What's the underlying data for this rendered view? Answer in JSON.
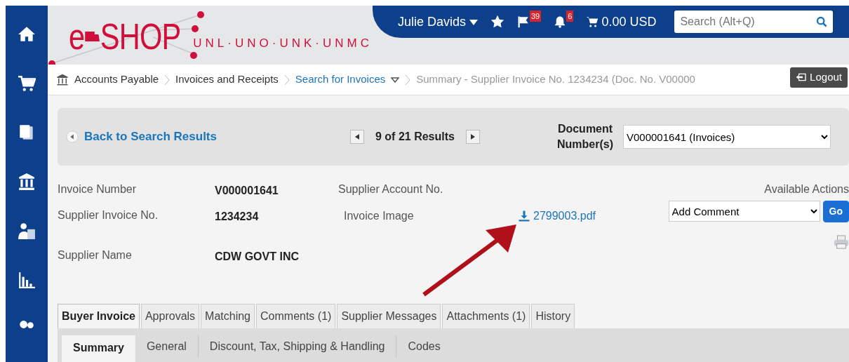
{
  "header": {
    "logo_letter": "e",
    "logo_word": "SHOP",
    "campuses": "UNL·UNO·UNK·UNMC",
    "user": "Julie Davids",
    "flag_count": "39",
    "notification_count": "6",
    "cart_total": "0.00 USD",
    "search": {
      "placeholder": "Search (Alt+Q)"
    }
  },
  "breadcrumb": [
    {
      "label": "Accounts Payable",
      "kind": "root"
    },
    {
      "label": "Invoices and Receipts",
      "kind": "plain"
    },
    {
      "label": "Search for Invoices",
      "kind": "menu"
    },
    {
      "label": "Summary - Supplier Invoice No. 1234234 (Doc. No. V00000",
      "kind": "current"
    }
  ],
  "logout": "Logout",
  "results_bar": {
    "back": "Back to Search Results",
    "position": "9 of 21 Results",
    "document_label": "Document Number(s)",
    "document_value": "V000001641 (Invoices)"
  },
  "details": {
    "fields": [
      {
        "label": "Invoice Number",
        "value": "V000001641"
      },
      {
        "label": "Supplier Invoice No.",
        "value": "1234234"
      },
      {
        "label": "Supplier Name",
        "value": "CDW GOVT INC"
      }
    ],
    "supplier_account_label": "Supplier Account No.",
    "invoice_image_label": "Invoice Image",
    "invoice_image_link": "2799003.pdf"
  },
  "actions": {
    "label": "Available Actions",
    "selected_action": "Add Comment",
    "go": "Go"
  },
  "tabs": [
    {
      "label": "Buyer Invoice",
      "selected": true
    },
    {
      "label": "Approvals",
      "selected": false
    },
    {
      "label": "Matching",
      "selected": false
    },
    {
      "label": "Comments (1)",
      "selected": false
    },
    {
      "label": "Supplier Messages",
      "selected": false
    },
    {
      "label": "Attachments (1)",
      "selected": false
    },
    {
      "label": "History",
      "selected": false
    }
  ],
  "subtabs": [
    {
      "label": "Summary",
      "selected": true
    },
    {
      "label": "General",
      "selected": false
    },
    {
      "label": "Discount, Tax, Shipping & Handling",
      "selected": false
    },
    {
      "label": "Codes",
      "selected": false
    }
  ]
}
